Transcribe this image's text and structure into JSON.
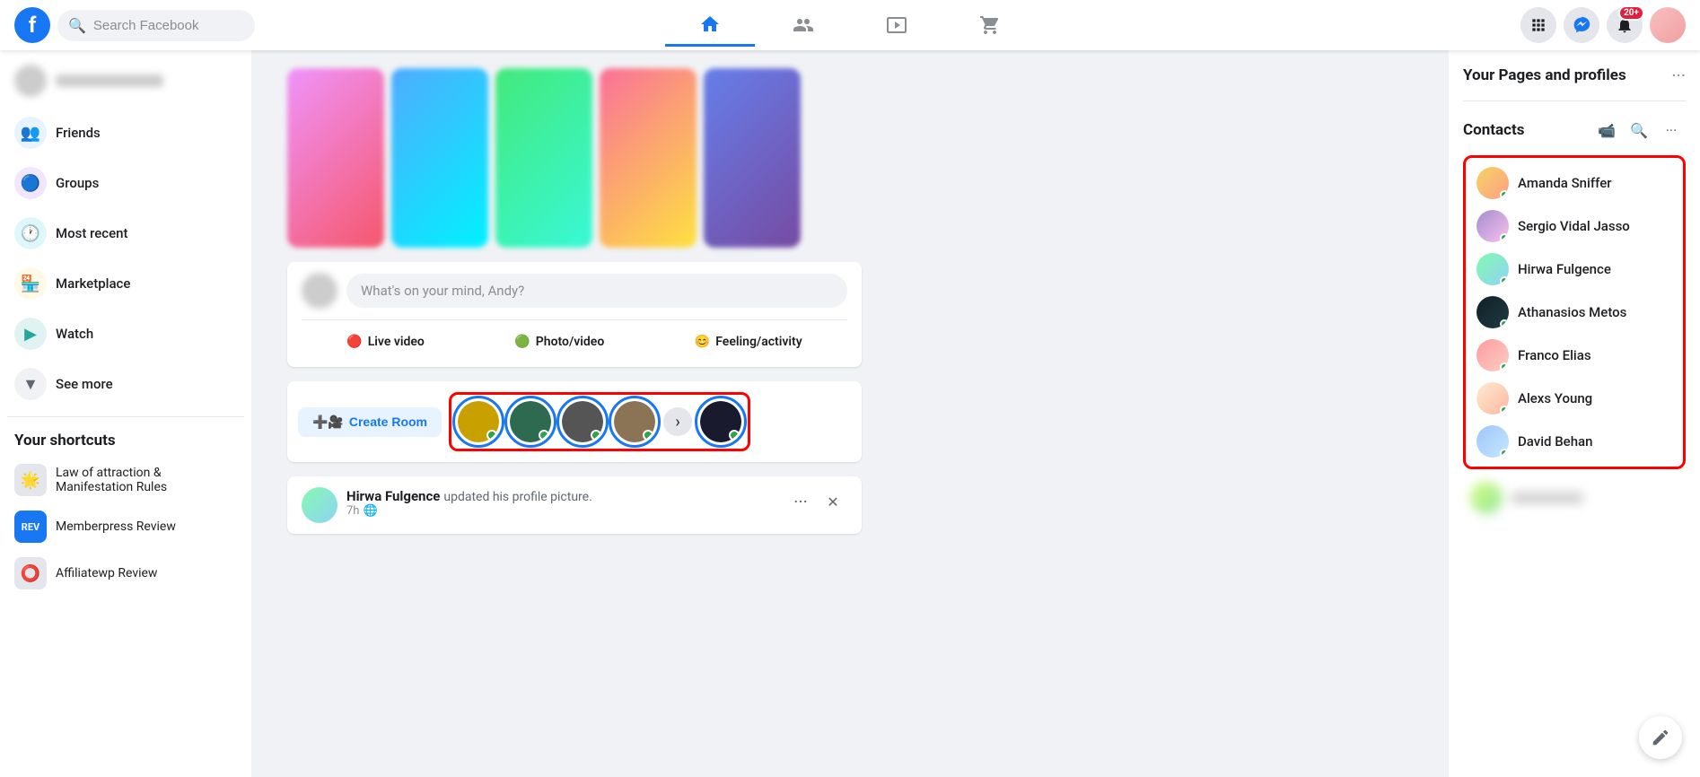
{
  "topnav": {
    "logo": "f",
    "search_placeholder": "Search Facebook",
    "nav_tabs": [
      {
        "id": "home",
        "label": "Home",
        "active": true
      },
      {
        "id": "friends",
        "label": "Friends",
        "active": false
      },
      {
        "id": "watch",
        "label": "Watch",
        "active": false
      },
      {
        "id": "marketplace",
        "label": "Marketplace",
        "active": false
      }
    ],
    "notification_count": "20+"
  },
  "left_sidebar": {
    "nav_items": [
      {
        "id": "friends",
        "label": "Friends",
        "icon": "👥"
      },
      {
        "id": "groups",
        "label": "Groups",
        "icon": "🔵"
      },
      {
        "id": "most_recent",
        "label": "Most recent",
        "icon": "🕐"
      },
      {
        "id": "marketplace",
        "label": "Marketplace",
        "icon": "🏪"
      },
      {
        "id": "watch",
        "label": "Watch",
        "icon": "▶"
      },
      {
        "id": "see_more",
        "label": "See more",
        "icon": "▼"
      }
    ],
    "shortcuts_title": "Your shortcuts",
    "shortcuts": [
      {
        "id": "law_attraction",
        "label": "Law of attraction & Manifestation Rules",
        "icon": "🌟"
      },
      {
        "id": "memberpress",
        "label": "Memberpress Review",
        "icon": "📄"
      },
      {
        "id": "affiliatewp",
        "label": "Affiliatewp Review",
        "icon": "⭕"
      }
    ]
  },
  "post_box": {
    "placeholder": "What's on your mind, Andy?",
    "actions": [
      {
        "id": "live_video",
        "label": "Live video",
        "icon": "🔴"
      },
      {
        "id": "photo_video",
        "label": "Photo/video",
        "icon": "🟢"
      },
      {
        "id": "feeling",
        "label": "Feeling/activity",
        "icon": "😊"
      }
    ]
  },
  "room_bar": {
    "create_room_label": "Create Room",
    "create_room_icon": "➕"
  },
  "story_avatars": [
    {
      "id": "sa1",
      "color": "sa1"
    },
    {
      "id": "sa2",
      "color": "sa2"
    },
    {
      "id": "sa3",
      "color": "sa3"
    },
    {
      "id": "sa4",
      "color": "sa4"
    },
    {
      "id": "sa5",
      "color": "sa5"
    },
    {
      "id": "sa6",
      "color": "sa6"
    }
  ],
  "post": {
    "author": "Hirwa Fulgence",
    "action": "updated his profile picture.",
    "time": "7h",
    "globe_icon": "🌐",
    "options_icon": "···",
    "close_icon": "✕"
  },
  "right_sidebar": {
    "pages_profiles_title": "Your Pages and profiles",
    "more_icon": "···",
    "contacts_title": "Contacts",
    "contacts": [
      {
        "id": "c1",
        "name": "Amanda Sniffer",
        "online": true,
        "color": "ca1"
      },
      {
        "id": "c2",
        "name": "Sergio Vidal Jasso",
        "online": true,
        "color": "ca2"
      },
      {
        "id": "c3",
        "name": "Hirwa Fulgence",
        "online": true,
        "color": "ca3"
      },
      {
        "id": "c4",
        "name": "Athanasios Metos",
        "online": true,
        "color": "ca4"
      },
      {
        "id": "c5",
        "name": "Franco Elias",
        "online": true,
        "color": "ca5"
      },
      {
        "id": "c6",
        "name": "Alexs Young",
        "online": true,
        "color": "ca6"
      },
      {
        "id": "c7",
        "name": "David Behan",
        "online": true,
        "color": "ca7"
      }
    ]
  }
}
